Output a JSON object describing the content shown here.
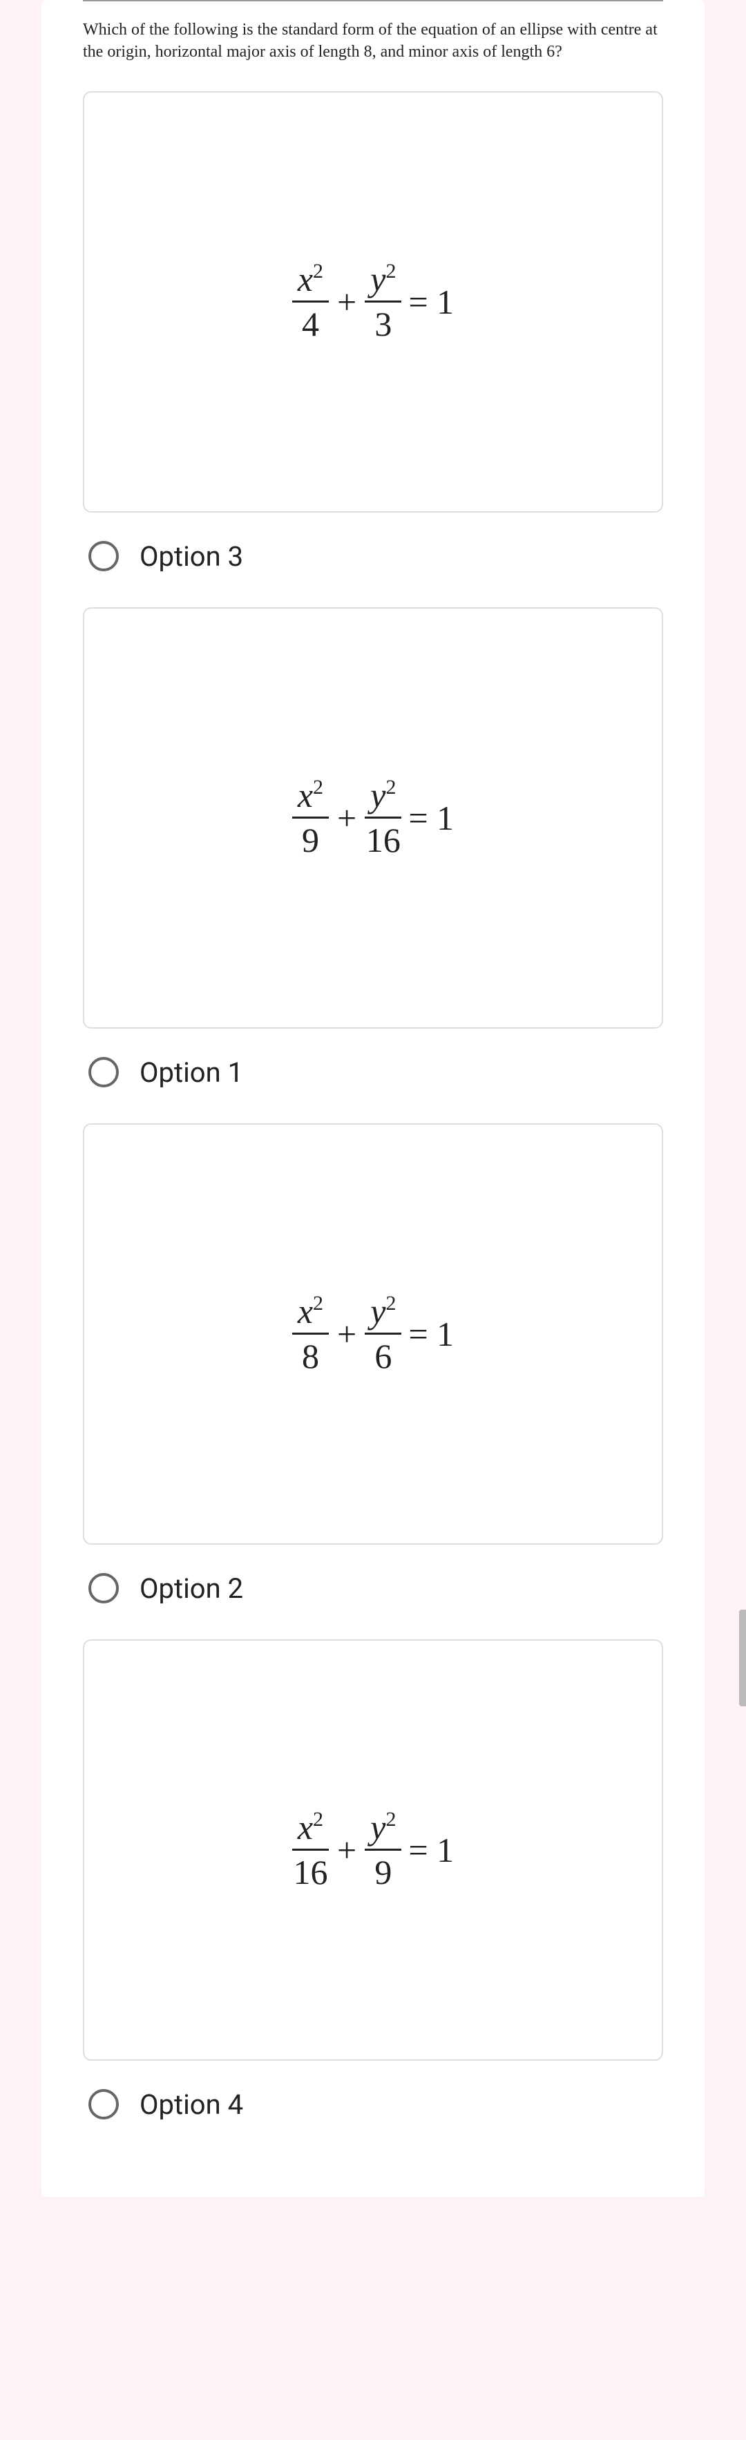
{
  "question": "Which of the following is the standard form of the equation of an ellipse with centre at the origin, horizontal major axis of length 8, and minor axis of length 6?",
  "options": [
    {
      "label": "Option 3",
      "equation": {
        "xden": "4",
        "yden": "3"
      }
    },
    {
      "label": "Option 1",
      "equation": {
        "xden": "9",
        "yden": "16"
      }
    },
    {
      "label": "Option 2",
      "equation": {
        "xden": "8",
        "yden": "6"
      }
    },
    {
      "label": "Option 4",
      "equation": {
        "xden": "16",
        "yden": "9"
      }
    }
  ],
  "eq_parts": {
    "x_num": "x",
    "y_num": "y",
    "sq": "2",
    "plus": "+",
    "equals_one": "= 1"
  }
}
